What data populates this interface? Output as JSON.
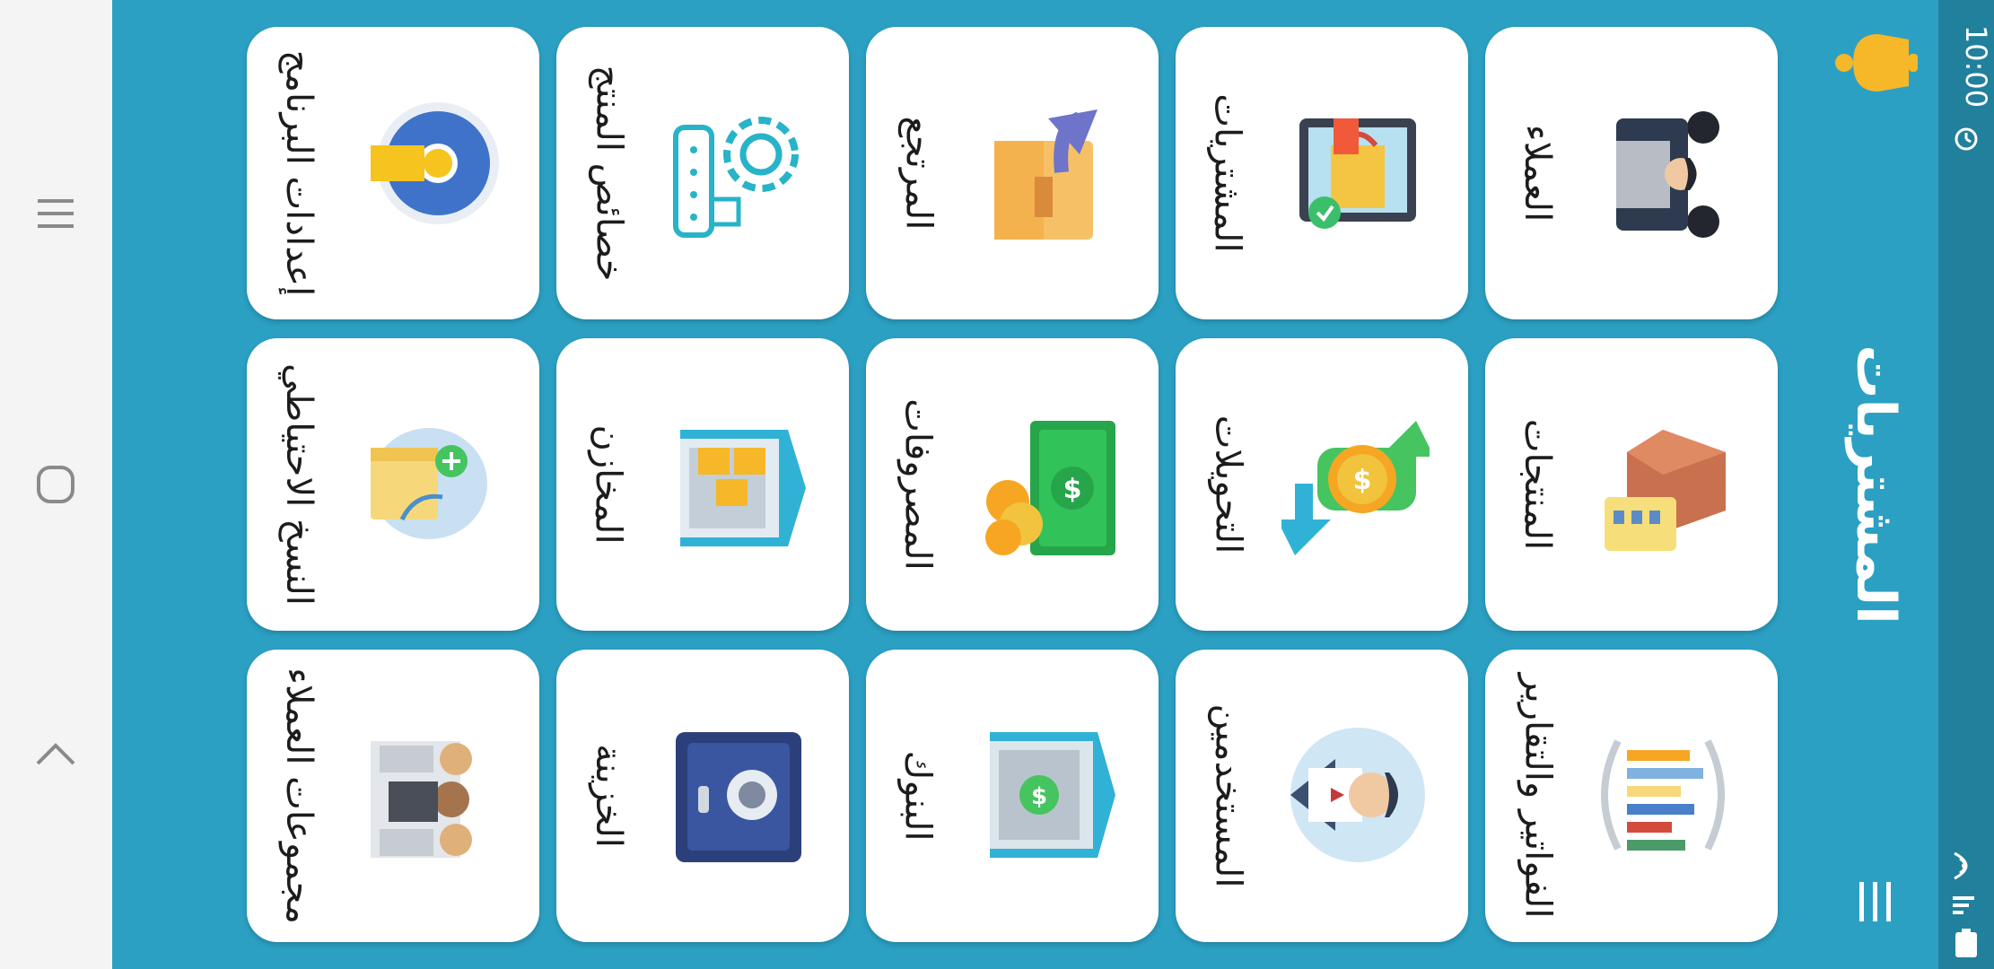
{
  "app": {
    "title": "المشتريات"
  },
  "status_bar": {
    "time": "10:00"
  },
  "tiles": [
    {
      "label": "العملاء",
      "icon": "customers-icon"
    },
    {
      "label": "المشتريات",
      "icon": "shopping-icon"
    },
    {
      "label": "المرتجع",
      "icon": "returns-icon"
    },
    {
      "label": "خصائص المنتج",
      "icon": "product-settings-icon"
    },
    {
      "label": "إعدادات البرنامج",
      "icon": "app-settings-icon"
    },
    {
      "label": "المنتجات",
      "icon": "products-icon"
    },
    {
      "label": "التحويلات",
      "icon": "transfers-icon"
    },
    {
      "label": "المصروفات",
      "icon": "expenses-icon"
    },
    {
      "label": "المخازن",
      "icon": "warehouses-icon"
    },
    {
      "label": "النسخ الاحتياطي",
      "icon": "backup-icon"
    },
    {
      "label": "الفواتير والتقارير",
      "icon": "reports-icon"
    },
    {
      "label": "المستخدمين",
      "icon": "users-icon"
    },
    {
      "label": "البنوك",
      "icon": "bank-icon"
    },
    {
      "label": "الخزينة",
      "icon": "safe-icon"
    },
    {
      "label": "مجموعات العملاء",
      "icon": "customer-groups-icon"
    }
  ]
}
